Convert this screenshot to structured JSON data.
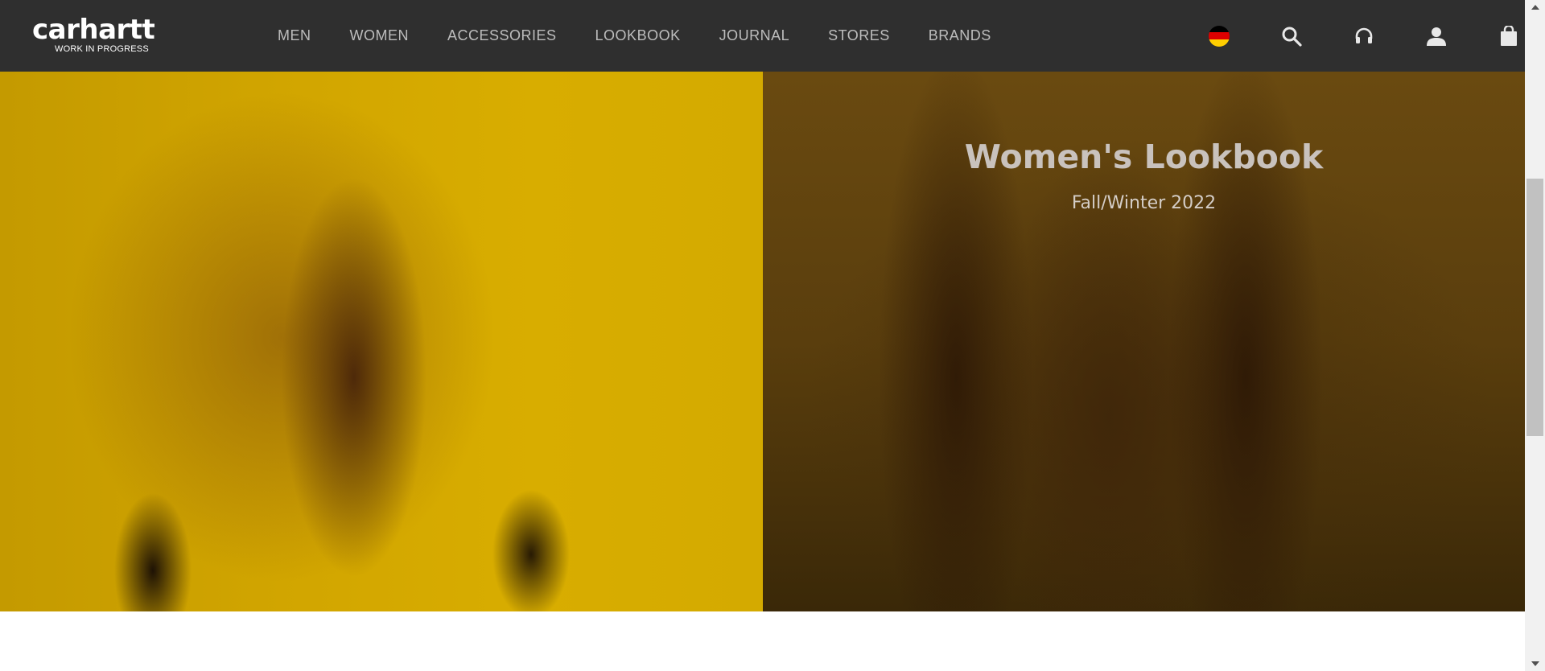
{
  "header": {
    "logo": {
      "wordmark": "carhartt",
      "tagline": "WORK IN PROGRESS"
    },
    "nav": [
      "MEN",
      "WOMEN",
      "ACCESSORIES",
      "LOOKBOOK",
      "JOURNAL",
      "STORES",
      "BRANDS"
    ],
    "icons": [
      "germany-flag-icon",
      "search-icon",
      "headset-icon",
      "user-icon",
      "shopping-bag-icon"
    ]
  },
  "hero": {
    "title": "Women's Lookbook",
    "subtitle": "Fall/Winter 2022"
  },
  "colors": {
    "header_bg": "#2f2f2f",
    "nav_text": "#bdbdbd",
    "accent_yellow": "#d2a600"
  }
}
